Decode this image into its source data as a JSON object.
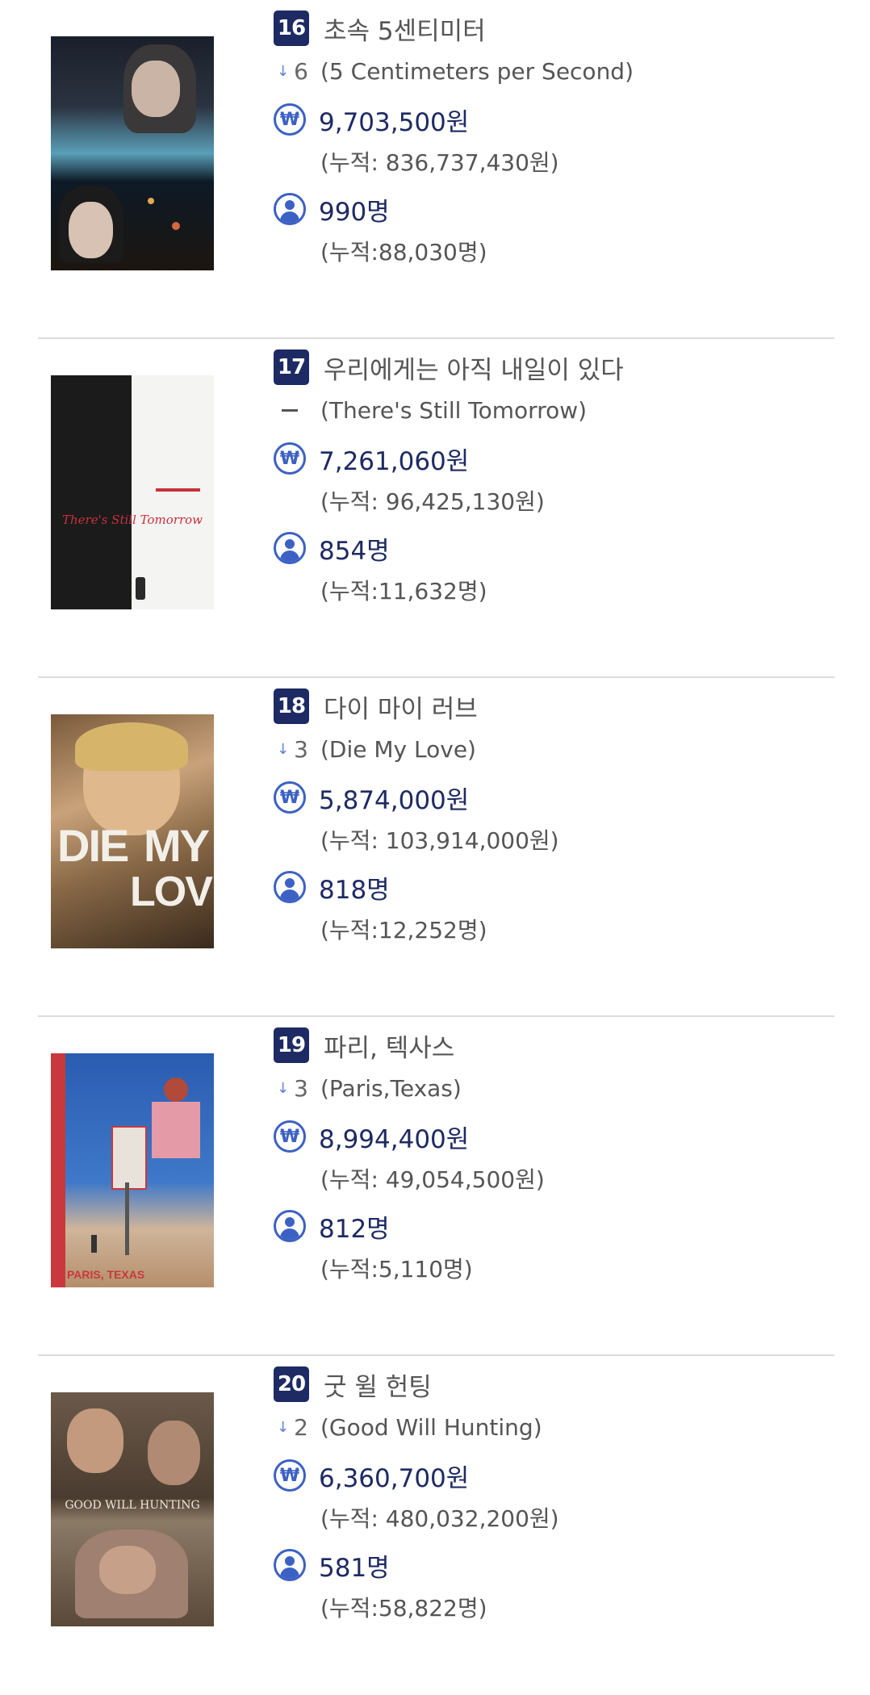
{
  "items": [
    {
      "rank": "16",
      "title_ko": "초속 5센티미터",
      "change_value": "6",
      "title_en": "(5 Centimeters per Second)",
      "revenue": "9,703,500원",
      "revenue_cum": "(누적: 836,737,430원)",
      "audience": "990명",
      "audience_cum": "(누적:88,030명)"
    },
    {
      "rank": "17",
      "title_ko": "우리에게는 아직 내일이 있다",
      "change_value": "",
      "title_en": "(There's Still Tomorrow)",
      "revenue": "7,261,060원",
      "revenue_cum": "(누적: 96,425,130원)",
      "audience": "854명",
      "audience_cum": "(누적:11,632명)",
      "poster_text": "There's Still Tomorrow"
    },
    {
      "rank": "18",
      "title_ko": "다이 마이 러브",
      "change_value": "3",
      "title_en": "(Die My Love)",
      "revenue": "5,874,000원",
      "revenue_cum": "(누적: 103,914,000원)",
      "audience": "818명",
      "audience_cum": "(누적:12,252명)",
      "poster_text_1": "DIE",
      "poster_text_2": "MY",
      "poster_text_3": "LOVE"
    },
    {
      "rank": "19",
      "title_ko": "파리, 텍사스",
      "change_value": "3",
      "title_en": "(Paris,Texas)",
      "revenue": "8,994,400원",
      "revenue_cum": "(누적: 49,054,500원)",
      "audience": "812명",
      "audience_cum": "(누적:5,110명)",
      "poster_text": "PARIS, TEXAS"
    },
    {
      "rank": "20",
      "title_ko": "굿 윌 헌팅",
      "change_value": "2",
      "title_en": "(Good Will Hunting)",
      "revenue": "6,360,700원",
      "revenue_cum": "(누적: 480,032,200원)",
      "audience": "581명",
      "audience_cum": "(누적:58,822명)",
      "poster_text": "GOOD WILL HUNTING"
    }
  ],
  "icons": {
    "revenue": "won-icon",
    "revenue_glyph": "₩",
    "audience": "person-icon",
    "change_down": "arrow-down-icon",
    "change_none": "dash-icon"
  },
  "colors": {
    "badge": "#1d2a63",
    "icon": "#3c61c4",
    "value_text": "#1d2a63",
    "divider": "#dcdcdc"
  }
}
